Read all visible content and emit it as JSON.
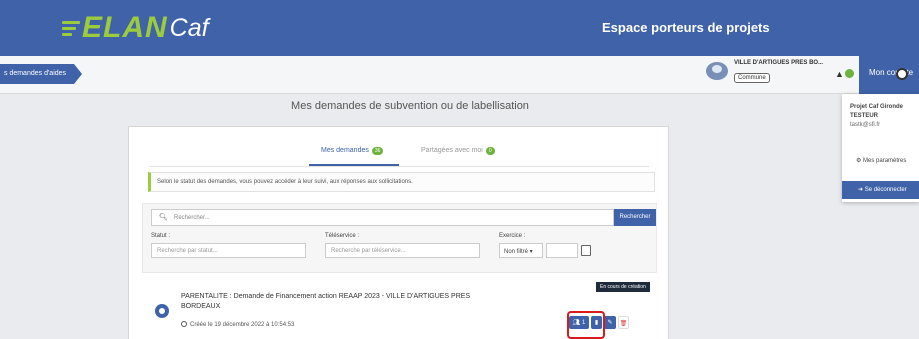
{
  "header": {
    "logo_main": "ELAN",
    "logo_suffix": "Caf",
    "title": "Espace porteurs de projets",
    "brand_color": "#3f62a8",
    "accent_color": "#9ccc3c"
  },
  "subbar": {
    "breadcrumb": "s demandes d'aides",
    "account_name": "VILLE D'ARTIGUES PRES BO...",
    "account_type": "Commune",
    "bell_icon": "bell-icon",
    "account_menu": "Mon compte"
  },
  "dropdown": {
    "project": "Projet Caf Gironde",
    "user": "TESTEUR",
    "email": "tastk@sfi.fr",
    "params": "Mes paramètres",
    "logout": "Se déconnecter"
  },
  "page": {
    "title": "Mes demandes de subvention ou de labellisation"
  },
  "tabs": [
    {
      "label": "Mes demandes",
      "count": "36",
      "active": true
    },
    {
      "label": "Partagées avec moi",
      "count": "0",
      "active": false
    }
  ],
  "info": "Selon le statut des demandes, vous pouvez accéder à leur suivi, aux réponses aux sollicitations.",
  "search": {
    "placeholder": "Rechercher...",
    "button": "Rechercher",
    "status_label": "Statut :",
    "status_placeholder": "Recherche par statut...",
    "teleservice_label": "Téléservice :",
    "teleservice_placeholder": "Recherche par téléservice...",
    "exercise_label": "Exercice :",
    "exercise_value": "Non filtré ▾"
  },
  "request": {
    "status": "En cours de création",
    "title": "PARENTALITE : Demande de Financement action REAAP 2023 - VILLE D'ARTIGUES PRES BORDEAUX",
    "created": "Créée le 19 décembre 2022 à 10:54:53",
    "users_button_count": "1"
  }
}
